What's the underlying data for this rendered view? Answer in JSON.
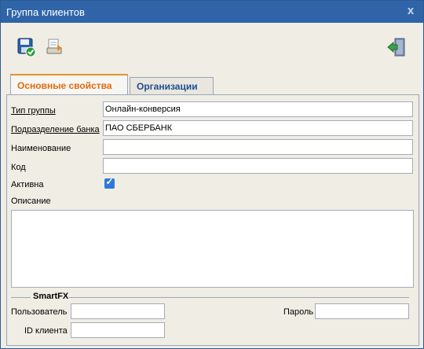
{
  "window": {
    "title": "Группа клиентов",
    "close_label": "x"
  },
  "toolbar": {
    "save": {
      "icon": "save-icon"
    },
    "export": {
      "icon": "export-icon"
    },
    "exit": {
      "icon": "exit-icon"
    }
  },
  "tabs": [
    {
      "label": "Основные свойства",
      "active": true
    },
    {
      "label": "Организации",
      "active": false
    }
  ],
  "form": {
    "group_type": {
      "label": "Тип группы",
      "value": "Онлайн-конверсия"
    },
    "bank_division": {
      "label": "Подразделение банка",
      "value": "ПАО СБЕРБАНК"
    },
    "name": {
      "label": "Наименование",
      "value": ""
    },
    "code": {
      "label": "Код",
      "value": ""
    },
    "active": {
      "label": "Активна",
      "checked": true
    },
    "description": {
      "label": "Описание",
      "value": ""
    }
  },
  "smartfx": {
    "legend": "SmartFX",
    "user": {
      "label": "Пользователь",
      "value": ""
    },
    "password": {
      "label": "Пароль",
      "value": ""
    },
    "client_id": {
      "label": "ID клиента",
      "value": ""
    }
  },
  "colors": {
    "titlebar": "#2f65a8",
    "active_tab": "#e06a10",
    "inactive_tab": "#1f4f8f",
    "checkbox": "#2f7ad9"
  }
}
